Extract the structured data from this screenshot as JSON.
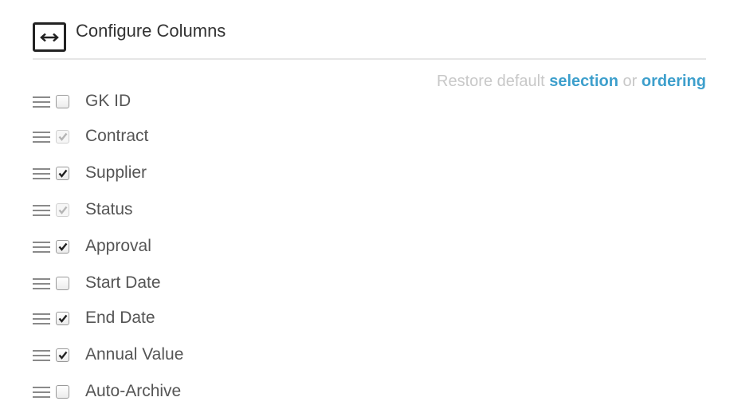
{
  "header": {
    "title": "Configure Columns",
    "icon": "horizontal-resize-icon"
  },
  "restore": {
    "prefix": "Restore default",
    "selection_link": "selection",
    "or_text": "or",
    "ordering_link": "ordering"
  },
  "colors": {
    "link": "#3d9fcc",
    "muted_text": "#c8c8c8",
    "label_text": "#555555"
  },
  "columns": [
    {
      "label": "GK ID",
      "checked": false,
      "disabled": false
    },
    {
      "label": "Contract",
      "checked": true,
      "disabled": true
    },
    {
      "label": "Supplier",
      "checked": true,
      "disabled": false
    },
    {
      "label": "Status",
      "checked": true,
      "disabled": true
    },
    {
      "label": "Approval",
      "checked": true,
      "disabled": false
    },
    {
      "label": "Start Date",
      "checked": false,
      "disabled": false
    },
    {
      "label": "End Date",
      "checked": true,
      "disabled": false
    },
    {
      "label": "Annual Value",
      "checked": true,
      "disabled": false
    },
    {
      "label": "Auto-Archive",
      "checked": false,
      "disabled": false
    }
  ]
}
